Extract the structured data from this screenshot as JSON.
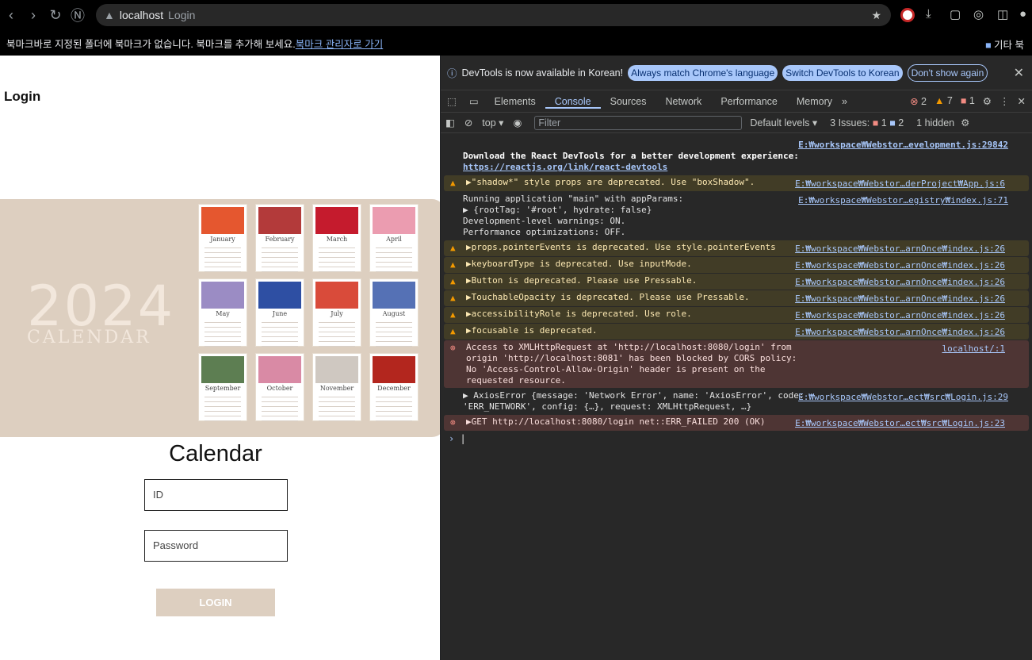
{
  "browser": {
    "host": "localhost",
    "tab_title": "Login",
    "bookmark_message": "북마크바로 지정된 폴더에 북마크가 없습니다. 북마크를 추가해 보세요.",
    "bookmark_link": "북마크 관리자로 가기",
    "other_bookmarks": "기타 북"
  },
  "page": {
    "title": "Login",
    "hero": {
      "year": "2024",
      "calendar_word": "CALENDAR",
      "months": [
        "January",
        "February",
        "March",
        "April",
        "May",
        "June",
        "July",
        "August",
        "September",
        "October",
        "November",
        "December"
      ]
    },
    "app_title": "Calendar",
    "id_placeholder": "ID",
    "password_placeholder": "Password",
    "login_label": "LOGIN"
  },
  "devtools": {
    "banner": {
      "text": "DevTools is now available in Korean!",
      "btn1": "Always match Chrome's language",
      "btn2": "Switch DevTools to Korean",
      "btn3": "Don't show again"
    },
    "tabs": [
      "Elements",
      "Console",
      "Sources",
      "Network",
      "Performance",
      "Memory"
    ],
    "active_tab": "Console",
    "badges": {
      "errors": "2",
      "warnings": "7",
      "issues": "1"
    },
    "toolbar": {
      "context": "top",
      "filter_placeholder": "Filter",
      "levels": "Default levels",
      "issues_label": "3 Issues:",
      "issues_err": "1",
      "issues_info": "2",
      "hidden": "1 hidden"
    },
    "logs": [
      {
        "kind": "info",
        "text": "Download the React DevTools for a better development experience:",
        "link": "https://reactjs.org/link/react-devtools",
        "src": "E:₩workspace₩Webstor…evelopment.js:29842"
      },
      {
        "kind": "warn",
        "text": "▶\"shadow*\" style props are deprecated. Use \"boxShadow\".",
        "src": "E:₩workspace₩Webstor…derProject₩App.js:6"
      },
      {
        "kind": "info",
        "text": "Running application \"main\" with appParams:",
        "sub1": "▶ {rootTag: '#root', hydrate: false}",
        "sub2": "Development-level warnings: ON.",
        "sub3": "Performance optimizations: OFF.",
        "src": "E:₩workspace₩Webstor…egistry₩index.js:71"
      },
      {
        "kind": "warn",
        "text": "▶props.pointerEvents is deprecated. Use style.pointerEvents",
        "src": "E:₩workspace₩Webstor…arnOnce₩index.js:26"
      },
      {
        "kind": "warn",
        "text": "▶keyboardType is deprecated. Use inputMode.",
        "src": "E:₩workspace₩Webstor…arnOnce₩index.js:26"
      },
      {
        "kind": "warn",
        "text": "▶Button is deprecated. Please use Pressable.",
        "src": "E:₩workspace₩Webstor…arnOnce₩index.js:26"
      },
      {
        "kind": "warn",
        "text": "▶TouchableOpacity is deprecated. Please use Pressable.",
        "src": "E:₩workspace₩Webstor…arnOnce₩index.js:26"
      },
      {
        "kind": "warn",
        "text": "▶accessibilityRole is deprecated. Use role.",
        "src": "E:₩workspace₩Webstor…arnOnce₩index.js:26"
      },
      {
        "kind": "warn",
        "text": "▶focusable is deprecated.",
        "src": "E:₩workspace₩Webstor…arnOnce₩index.js:26"
      },
      {
        "kind": "err",
        "text": "Access to XMLHttpRequest at 'http://localhost:8080/login' from origin 'http://localhost:8081' has been blocked by CORS policy: No 'Access-Control-Allow-Origin' header is present on the requested resource.",
        "src": "localhost/:1"
      },
      {
        "kind": "info",
        "text": "▶ AxiosError {message: 'Network Error', name: 'AxiosError', code: 'ERR_NETWORK', config: {…}, request: XMLHttpRequest, …}",
        "src": "E:₩workspace₩Webstor…ect₩src₩Login.js:29"
      },
      {
        "kind": "err",
        "text": "▶GET http://localhost:8080/login net::ERR_FAILED 200 (OK)",
        "src": "E:₩workspace₩Webstor…ect₩src₩Login.js:23"
      }
    ],
    "prompt": "›"
  }
}
